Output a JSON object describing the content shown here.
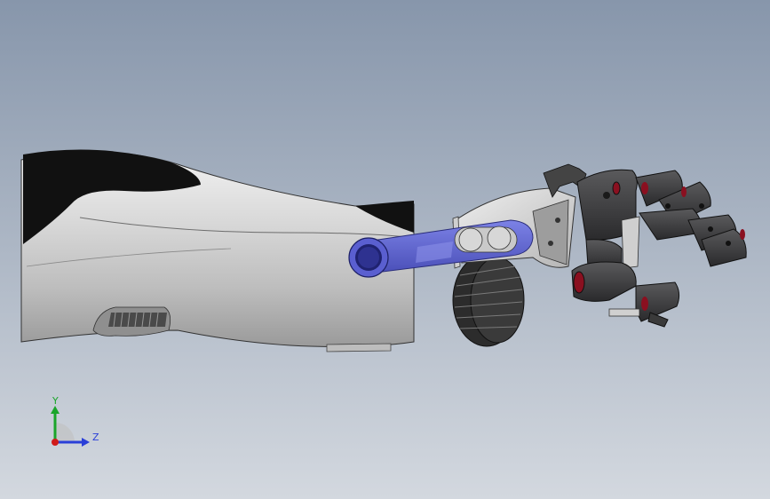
{
  "viewport": {
    "background_top": "#8796ab",
    "background_bottom": "#d3d8df"
  },
  "model": {
    "parts": [
      {
        "name": "forearm-socket",
        "color": "#c8c8c8"
      },
      {
        "name": "socket-liner",
        "color": "#111111"
      },
      {
        "name": "actuator-link",
        "color": "#5a5fd0"
      },
      {
        "name": "wrist-bracket",
        "color": "#d0d0d0"
      },
      {
        "name": "pulley-wheel",
        "color": "#3a3a3a"
      },
      {
        "name": "hand-fingers",
        "color": "#3c3c3e"
      },
      {
        "name": "finger-joint-accent",
        "color": "#8a1020"
      }
    ]
  },
  "triad": {
    "y_label": "Y",
    "z_label": "Z",
    "y_color": "#1aa52a",
    "z_color": "#2a3fd8",
    "x_color": "#d01a1a"
  }
}
